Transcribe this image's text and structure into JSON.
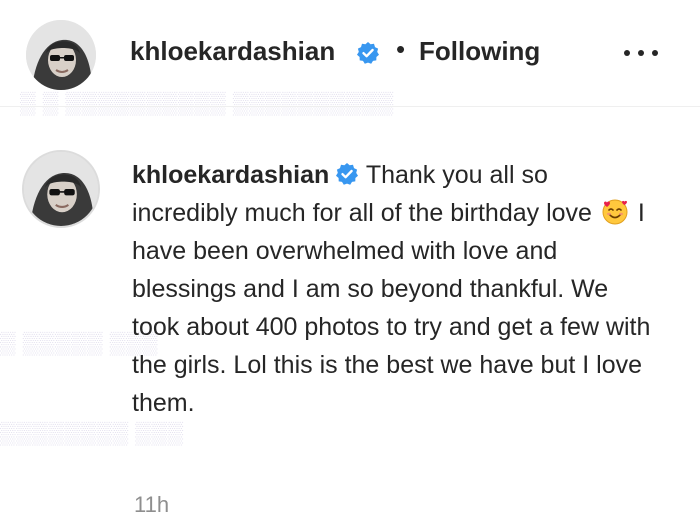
{
  "header": {
    "username": "khloekardashian",
    "separator": "•",
    "follow_status": "Following",
    "more_icon": "more-horizontal-icon"
  },
  "post": {
    "username": "khloekardashian",
    "caption_part1": "Thank you all so incredibly much for all of the birthday love",
    "emoji": "smiling-face-with-hearts-emoji",
    "caption_part2": "I have been overwhelmed with love and blessings and I am so beyond thankful. We took about 400 photos to try and get a few with the girls. Lol this is the best we have but I love them.",
    "timestamp": "11h"
  },
  "colors": {
    "text": "#262626",
    "muted": "#8e8e8e",
    "verified": "#3897f0"
  }
}
